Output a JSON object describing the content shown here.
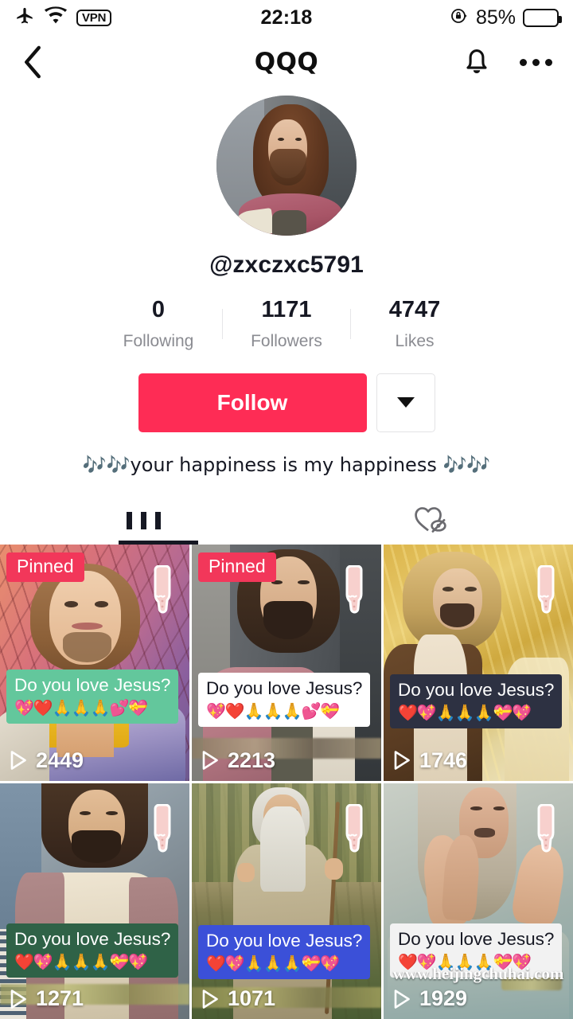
{
  "status_bar": {
    "airplane_icon": "airplane-icon",
    "wifi_icon": "wifi-icon",
    "vpn_label": "VPN",
    "time": "22:18",
    "rotation_lock_icon": "rotation-lock-icon",
    "battery_percent": "85%"
  },
  "header": {
    "back_icon": "chevron-left-icon",
    "title": "QQQ",
    "bell_icon": "bell-icon",
    "more_icon": "more-horizontal-icon"
  },
  "profile": {
    "avatar_alt": "avatar",
    "handle": "@zxczxc5791",
    "stats": [
      {
        "value": "0",
        "label": "Following"
      },
      {
        "value": "1171",
        "label": "Followers"
      },
      {
        "value": "4747",
        "label": "Likes"
      }
    ],
    "follow_label": "Follow",
    "dropdown_icon": "chevron-down-icon",
    "bio": "🎶🎶your happiness is my happiness 🎶🎶"
  },
  "tabs": [
    {
      "name": "videos",
      "icon": "grid-icon",
      "active": true
    },
    {
      "name": "liked",
      "icon": "heart-hidden-icon",
      "active": false
    }
  ],
  "videos": [
    {
      "pinned_label": "Pinned",
      "caption_text": "Do you love Jesus?",
      "caption_emojis": "💖❤️🙏🙏🙏💕💝",
      "caption_bg": "#63c79c",
      "caption_color": "#ffffff",
      "plays": "2449",
      "sticker_icon": "pointing-down-hand-icon"
    },
    {
      "pinned_label": "Pinned",
      "caption_text": "Do you love Jesus?",
      "caption_emojis": "💖❤️🙏🙏🙏💕💝",
      "caption_bg": "#ffffff",
      "caption_color": "#161823",
      "plays": "2213",
      "sticker_icon": "pointing-down-hand-icon"
    },
    {
      "pinned_label": "",
      "caption_text": "Do you love Jesus?",
      "caption_emojis": "❤️💖🙏🙏🙏💝💖",
      "caption_bg": "#2d3142",
      "caption_color": "#ffffff",
      "plays": "1746",
      "sticker_icon": "pointing-down-hand-icon"
    },
    {
      "pinned_label": "",
      "caption_text": "Do you love Jesus?",
      "caption_emojis": "❤️💖🙏🙏🙏💝💖",
      "caption_bg": "#2f6247",
      "caption_color": "#ffffff",
      "plays": "1271",
      "sticker_icon": "pointing-down-hand-icon"
    },
    {
      "pinned_label": "",
      "caption_text": "Do you love Jesus?",
      "caption_emojis": "❤️💖🙏🙏🙏💝💖",
      "caption_bg": "#3b50d8",
      "caption_color": "#ffffff",
      "plays": "1071",
      "sticker_icon": "pointing-down-hand-icon"
    },
    {
      "pinned_label": "",
      "caption_text": "Do you love Jesus?",
      "caption_emojis": "❤️💖🙏🙏🙏💝💖",
      "caption_bg": "#f2f2f2",
      "caption_color": "#161823",
      "plays": "1929",
      "sticker_icon": "pointing-down-hand-icon",
      "watermark": "www.heijingchuhai.com"
    }
  ],
  "colors": {
    "accent": "#FE2C55",
    "pinned_badge": "#F2375A",
    "text_primary": "#161823",
    "text_secondary": "#8a8b91"
  }
}
